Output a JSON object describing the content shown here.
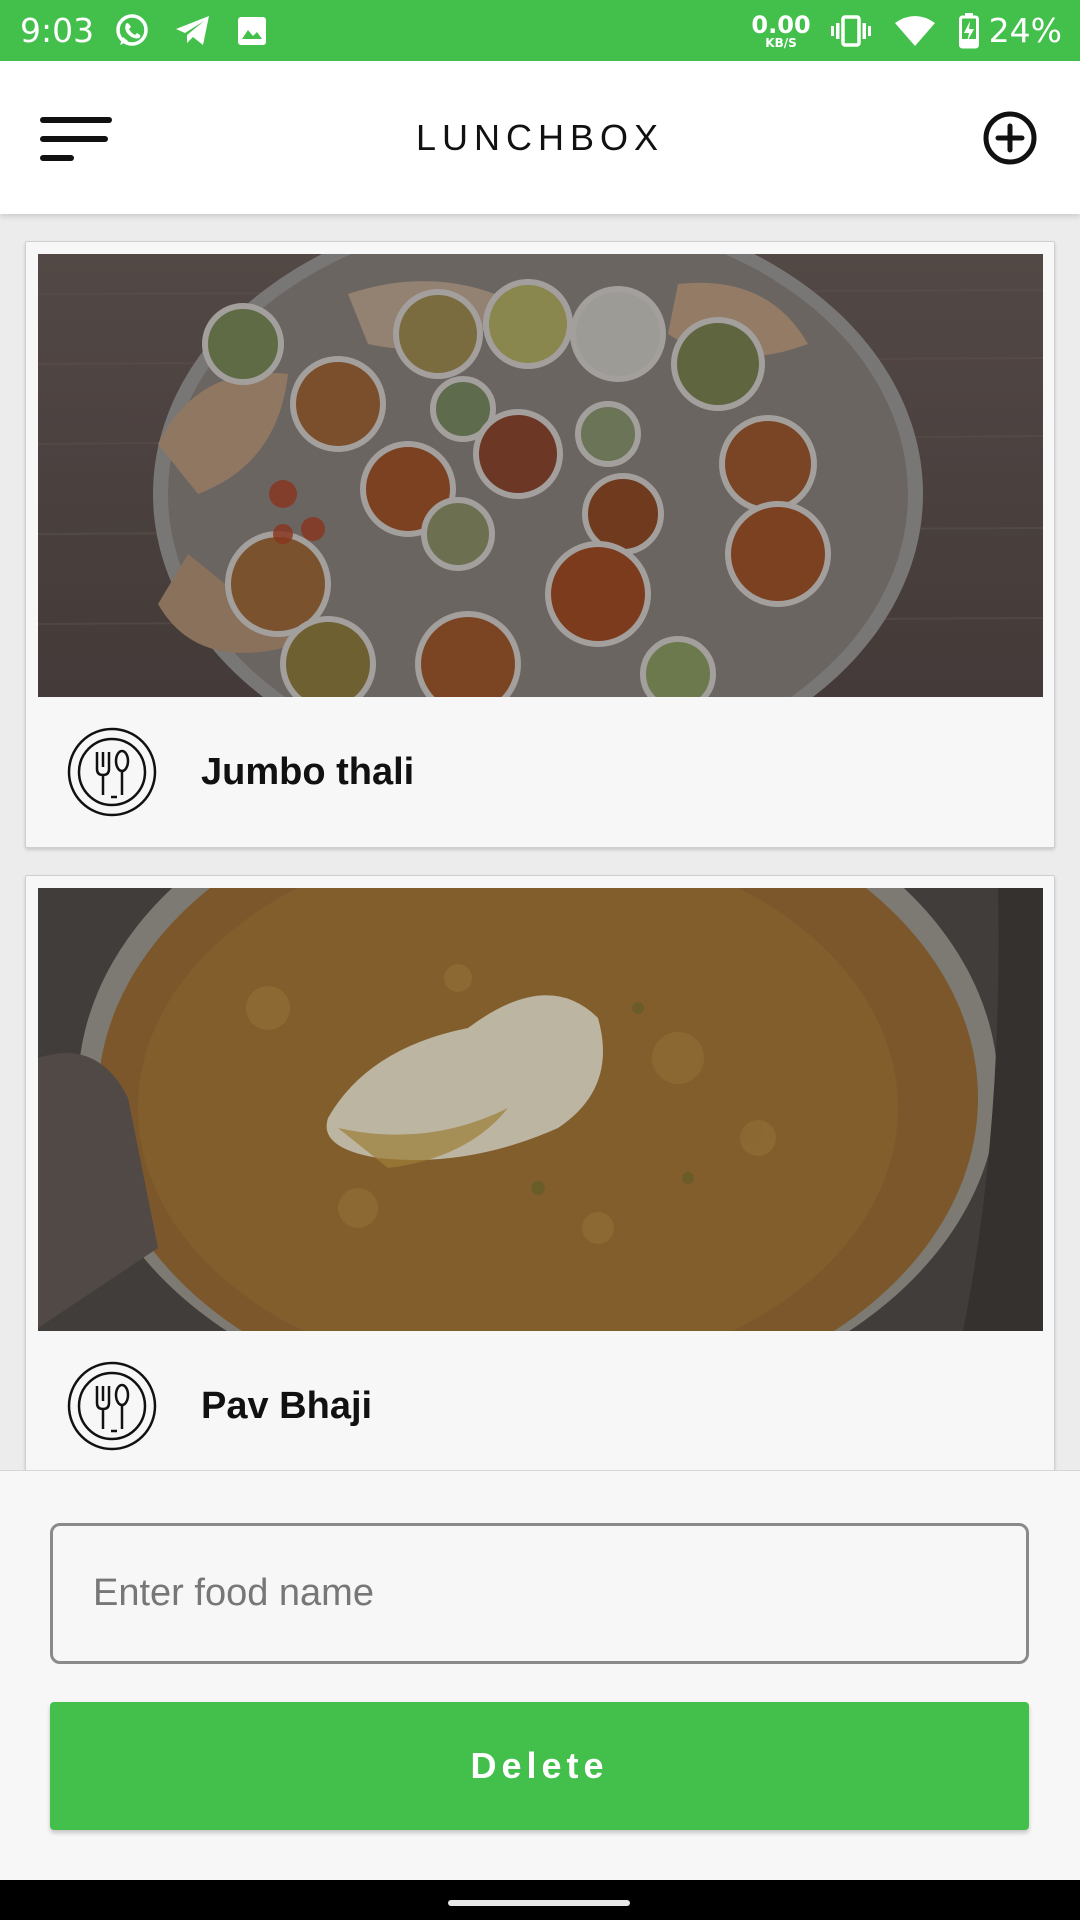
{
  "status_bar": {
    "time": "9:03",
    "net_speed_value": "0.00",
    "net_speed_unit": "KB/S",
    "battery_percent": "24%",
    "icons": [
      "whatsapp-icon",
      "telegram-icon",
      "gallery-icon",
      "vibrate-icon",
      "wifi-icon",
      "battery-charging-icon"
    ],
    "color": "#42c04b"
  },
  "app_bar": {
    "title": "LUNCHBOX",
    "menu_icon": "menu-icon",
    "add_icon": "add-circle-icon"
  },
  "food_list": [
    {
      "name": "Jumbo thali",
      "icon": "utensils-icon",
      "image": "thali-photo"
    },
    {
      "name": "Pav Bhaji",
      "icon": "utensils-icon",
      "image": "pav-bhaji-photo"
    }
  ],
  "form": {
    "food_name_placeholder": "Enter food name",
    "food_name_value": "",
    "delete_label": "Delete"
  },
  "colors": {
    "accent": "#42c04b",
    "background": "#ececec"
  }
}
